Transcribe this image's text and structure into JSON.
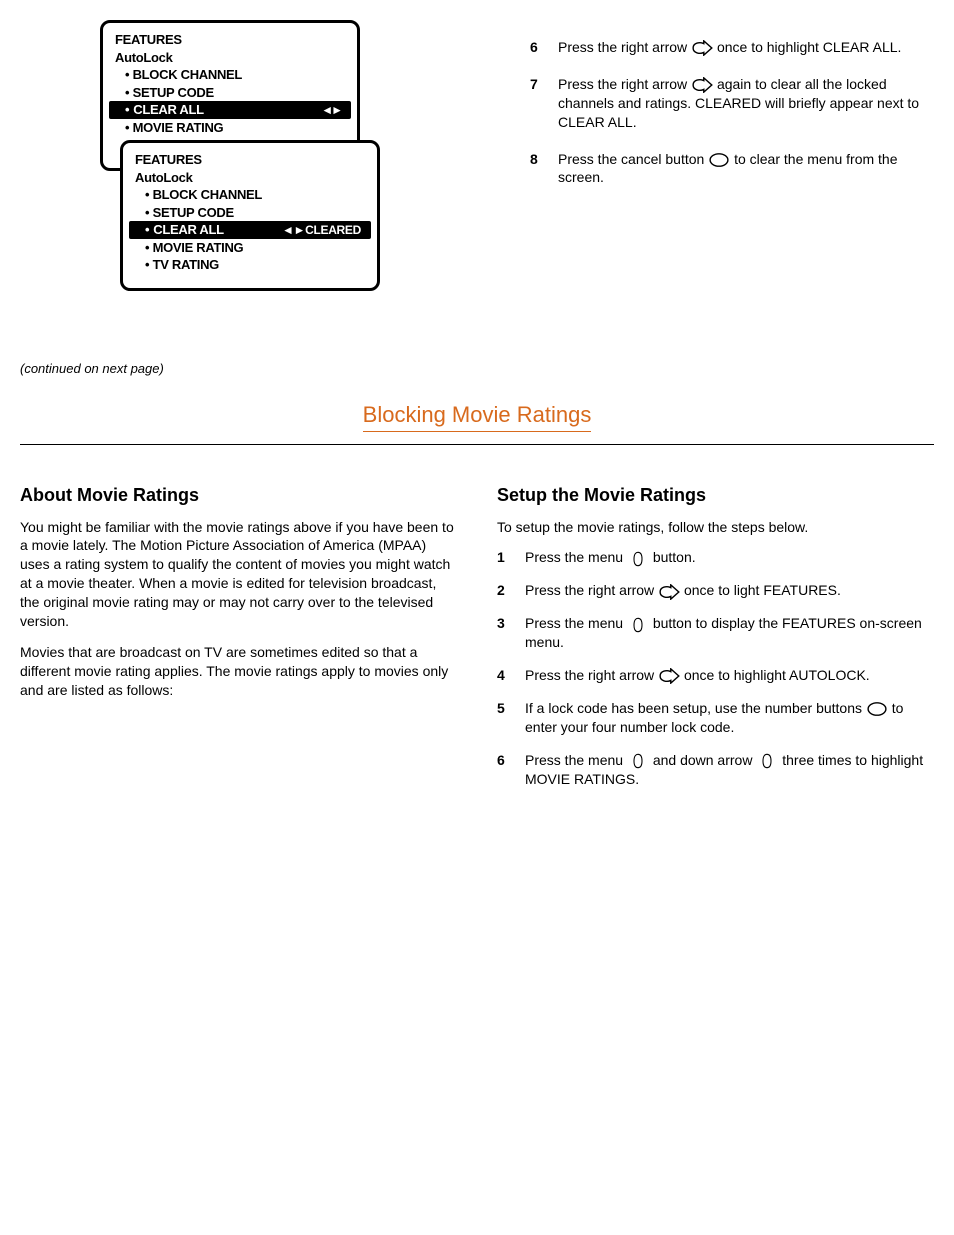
{
  "tv_menu": {
    "heading": "FEATURES",
    "subheading": "AutoLock",
    "items": [
      "BLOCK CHANNEL",
      "SETUP CODE",
      "CLEAR ALL",
      "MOVIE RATING",
      "TV RATING"
    ],
    "highlight_label": "CLEAR ALL",
    "arrows": "◄►",
    "status_cleared": "◄►CLEARED"
  },
  "top_steps": {
    "s6": {
      "num": "6",
      "text_before": "Press the right arrow ",
      "text_after": " once to highlight CLEAR ALL."
    },
    "s7": {
      "num": "7",
      "text_before": "Press the right arrow ",
      "text_after": " again to clear all the locked channels and ratings. CLEARED will briefly appear next to CLEAR ALL."
    },
    "s8": {
      "num": "8",
      "text_before": "Press the cancel button ",
      "text_after": " to clear the menu from the screen."
    }
  },
  "continued": "(continued on next page)",
  "section_title": "Blocking Movie Ratings",
  "left_col": {
    "h": "About Movie Ratings",
    "p1": "You might be familiar with the movie ratings above if you have been to a movie lately. The Motion Picture Association of America (MPAA) uses a rating system to qualify the content of movies you might watch at a movie theater. When a movie is edited for television broadcast, the original movie rating may or may not carry over to the televised version.",
    "p2": "Movies that are broadcast on TV are sometimes edited so that a different movie rating applies. The movie ratings apply to movies only and are listed as follows:"
  },
  "right_col": {
    "h": "Setup the Movie Ratings",
    "intro": "To setup the movie ratings, follow the steps below.",
    "s1": {
      "num": "1",
      "before": "Press the menu ",
      "after": " button."
    },
    "s2": {
      "num": "2",
      "before": "Press the right arrow ",
      "after": " once to light FEATURES."
    },
    "s3": {
      "num": "3",
      "before": "Press the menu ",
      "after": " button to display the FEATURES on-screen menu."
    },
    "s4": {
      "num": "4",
      "before": "Press the right arrow ",
      "after": " once to highlight AUTOLOCK."
    },
    "s5": {
      "num": "5",
      "text": "If a lock code has been setup, use the number buttons ",
      "mid": " to enter your four number lock code."
    },
    "s6": {
      "num": "6",
      "before": "Press the menu ",
      "mid": " and down arrow ",
      "after": " three times to highlight MOVIE RATINGS."
    }
  }
}
